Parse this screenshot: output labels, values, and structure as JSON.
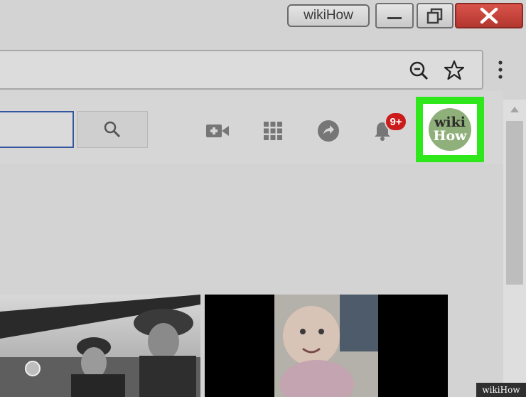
{
  "window": {
    "profile_name": "wikiHow",
    "controls": [
      "minimize",
      "maximize",
      "close"
    ]
  },
  "browser": {
    "address_icons": [
      "zoom-out-icon",
      "star-icon"
    ],
    "menu_icon": "kebab-menu-icon"
  },
  "header": {
    "search": {
      "value": "",
      "button_icon": "search-icon"
    },
    "icons": [
      "create-video-icon",
      "apps-grid-icon",
      "share-icon",
      "notifications-bell-icon"
    ],
    "notification_badge": "9+",
    "avatar": {
      "line1": "wiki",
      "line2": "How",
      "highlight_color": "#2ee81c"
    }
  },
  "content": {
    "videos": [
      {
        "thumbnail": "black-and-white soldiers"
      },
      {
        "thumbnail": "baby crawling"
      }
    ]
  },
  "watermark": "wikiHow"
}
